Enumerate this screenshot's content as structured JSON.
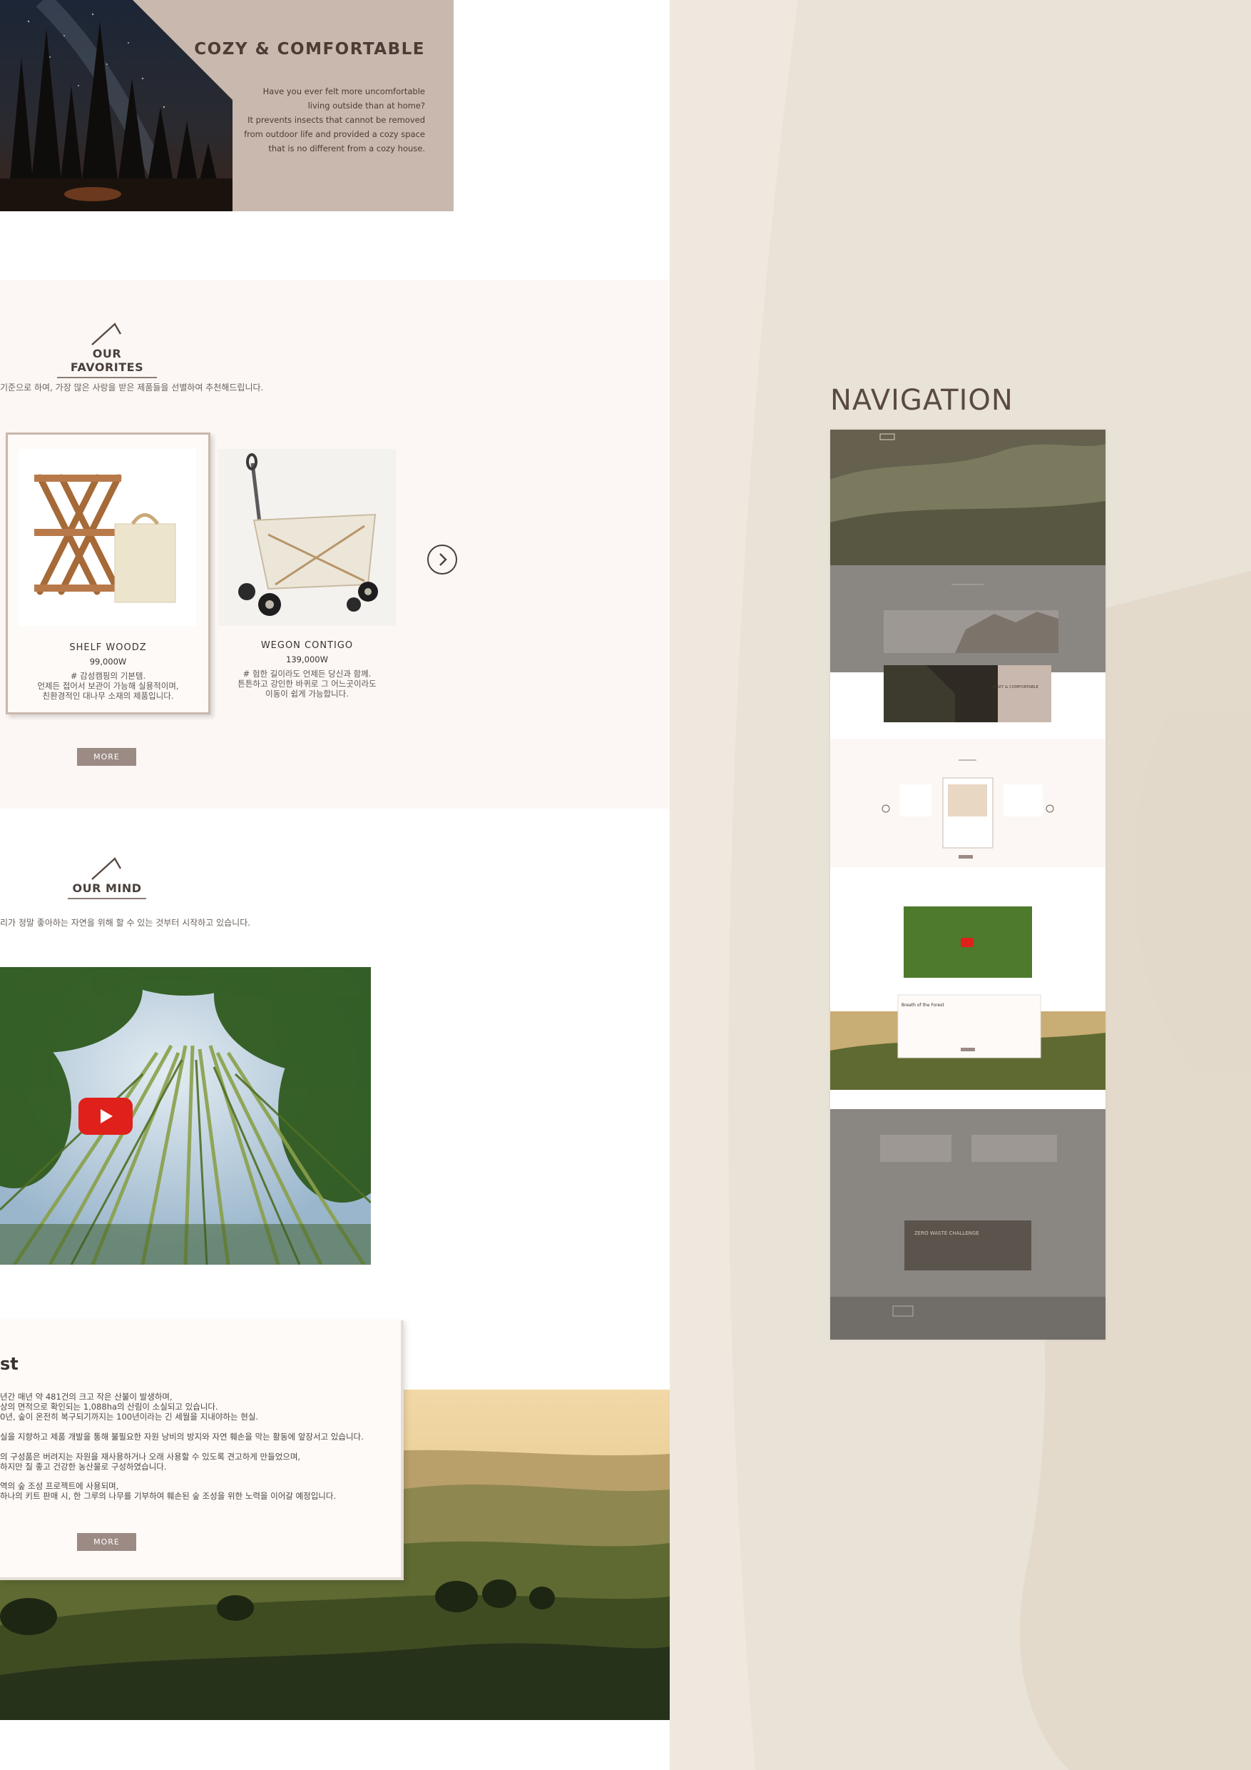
{
  "cozy": {
    "title": "COZY & COMFORTABLE",
    "lines": [
      "Have you ever felt more uncomfortable",
      "living outside than at home?",
      "It prevents insects that cannot be removed",
      "from outdoor life and provided a cozy space",
      "that is no different from a cozy house."
    ]
  },
  "favorites": {
    "title": "OUR FAVORITES",
    "subtitle": "기준으로 하여, 가장 많은 사랑을 받은 제품들을 선별하여 추천해드립니다.",
    "products": [
      {
        "name": "SHELF WOODZ",
        "price": "99,000W",
        "desc": [
          "# 감성캠핑의 기본템.",
          "언제든 접어서 보관이 가능해 실용적이며,",
          "친환경적인 대나무 소재의 제품입니다."
        ]
      },
      {
        "name": "WEGON CONTIGO",
        "price": "139,000W",
        "desc": [
          "# 험한 길이라도 언제든 당신과 함께.",
          "튼튼하고 강인한 바퀴로 그 어느곳이라도",
          "이동이 쉽게 가능합니다."
        ]
      }
    ],
    "more_label": "MORE"
  },
  "mind": {
    "title": "OUR MIND",
    "subtitle": "리가 정말 좋아하는 자연을 위해 할 수 있는 것부터 시작하고 있습니다."
  },
  "forest": {
    "title": "st",
    "lines": [
      "년간 매년 약 481건의 크고 작은 산불이 발생하며,",
      "상의 면적으로 확인되는 1,088ha의 산림이 소실되고 있습니다.",
      "0년, 숲이 온전히 복구되기까지는 100년이라는 긴 세월을 지내야하는 현실.",
      "실을 지향하고 제품 개발을 통해 불필요한 자원 낭비의 방지와 자연 훼손을 막는 활동에 앞장서고 있습니다.",
      "의 구성품은 버려지는 자원을 재사용하거나 오래 사용할 수 있도록 견고하게 만들었으며,",
      "하지만 질 좋고 건강한 농산물로 구성하였습니다.",
      "역의 숲 조성 프로젝트에 사용되며,",
      "하나의 키트 판매 시, 한 그루의 나무를 기부하여 훼손된 숲 조성을 위한 노력을 이어갈 예정입니다."
    ],
    "more_label": "MORE"
  },
  "navigation": {
    "title": "NAVIGATION",
    "mini": {
      "cozy_title": "COZY & COMFORTABLE",
      "breath_title": "Breath of the Forest",
      "zero_title": "ZERO WASTE CHALLENGE"
    }
  },
  "colors": {
    "cozy_bg": "#c9b8ad",
    "favorites_bg": "#fcf7f4",
    "more_btn": "#9c8a84",
    "paper_bg": "#eee8df",
    "youtube_red": "#e0201b"
  },
  "icons": [
    "roof-icon",
    "chevron-right-icon",
    "play-icon"
  ]
}
